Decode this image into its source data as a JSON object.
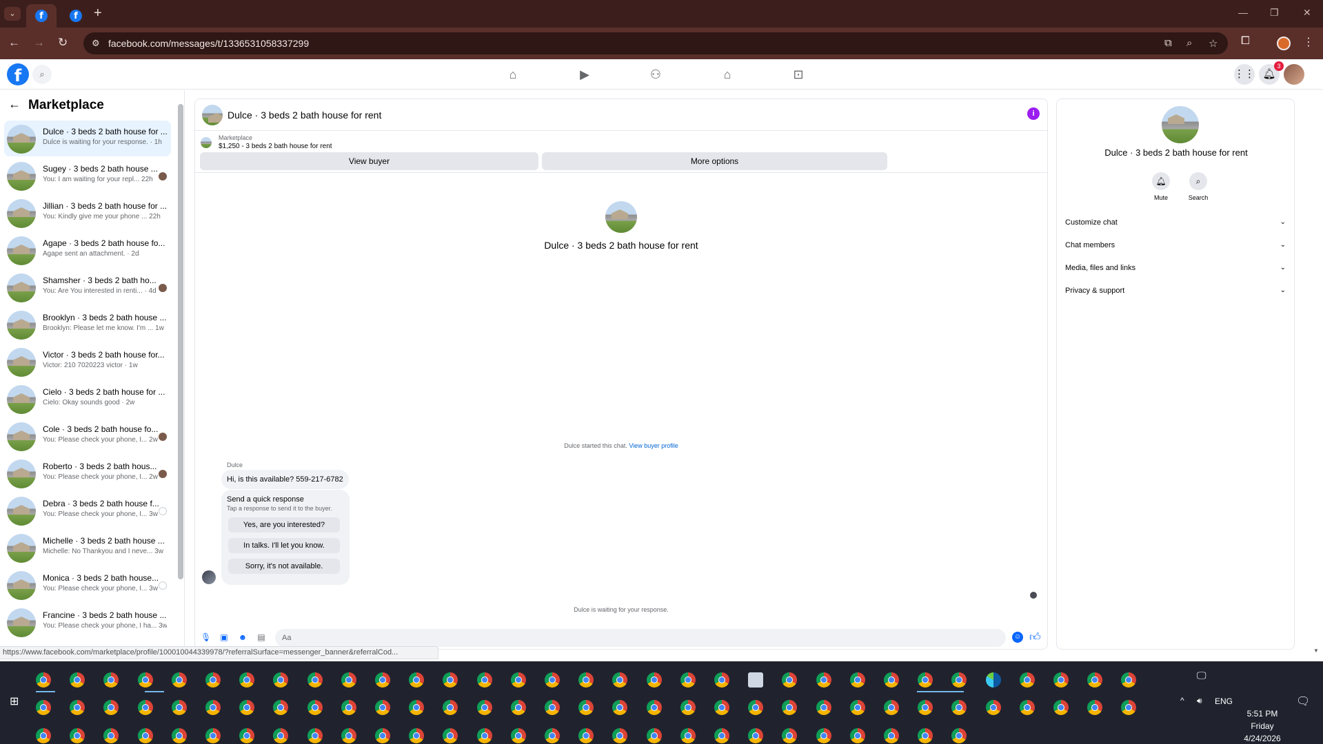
{
  "browser": {
    "url": "facebook.com/messages/t/1336531058337299",
    "status_url": "https://www.facebook.com/marketplace/profile/100010044339978/?referralSurface=messenger_banner&referralCod..."
  },
  "fb": {
    "logo_glyph": "f",
    "notifications_count": "3",
    "nav_icons": [
      "home-icon",
      "video-icon",
      "friends-icon",
      "marketplace-icon",
      "gaming-icon"
    ]
  },
  "sidebar": {
    "title": "Marketplace",
    "conversations": [
      {
        "title": "Dulce · 3 beds 2 bath house for ...",
        "subtitle": "Dulce is waiting for your response. · 1h",
        "mark": "none"
      },
      {
        "title": "Sugey · 3 beds 2 bath house ...",
        "subtitle": "You: I am waiting for your repl...  22h",
        "mark": "face"
      },
      {
        "title": "Jillian · 3 beds 2 bath house for ...",
        "subtitle": "You: Kindly give me your phone ...  22h",
        "mark": "none"
      },
      {
        "title": "Agape · 3 beds 2 bath house fo...",
        "subtitle": "Agape sent an attachment. · 2d",
        "mark": "none"
      },
      {
        "title": "Shamsher · 3 beds 2 bath ho...",
        "subtitle": "You: Are You interested in renti...  · 4d",
        "mark": "face"
      },
      {
        "title": "Brooklyn · 3 beds 2 bath house ...",
        "subtitle": "Brooklyn: Please let me know. I'm ...  1w",
        "mark": "none"
      },
      {
        "title": "Victor · 3 beds 2 bath house for...",
        "subtitle": "Victor: 210 7020223 victor · 1w",
        "mark": "none"
      },
      {
        "title": "Cielo · 3 beds 2 bath house for ...",
        "subtitle": "Cielo: Okay sounds good · 2w",
        "mark": "none"
      },
      {
        "title": "Cole · 3 beds 2 bath house fo...",
        "subtitle": "You: Please check your phone, I...  2w",
        "mark": "face"
      },
      {
        "title": "Roberto · 3 beds 2 bath hous...",
        "subtitle": "You: Please check your phone, I...  2w",
        "mark": "face"
      },
      {
        "title": "Debra · 3 beds 2 bath house f...",
        "subtitle": "You: Please check your phone, I...  3w",
        "mark": "ring"
      },
      {
        "title": "Michelle · 3 beds 2 bath house ...",
        "subtitle": "Michelle: No Thankyou and I neve...  3w",
        "mark": "none"
      },
      {
        "title": "Monica · 3 beds 2 bath house...",
        "subtitle": "You: Please check your phone, I...  3w",
        "mark": "ring"
      },
      {
        "title": "Francine · 3 beds 2 bath house ...",
        "subtitle": "You: Please check your phone, I ha...  3w",
        "mark": "none"
      }
    ]
  },
  "chat": {
    "title": "Dulce · 3 beds 2 bath house for rent",
    "marketplace_label": "Marketplace",
    "listing": "$1,250 - 3 beds 2 bath house for rent",
    "view_buyer": "View buyer",
    "more_options": "More options",
    "hero_title": "Dulce · 3 beds 2 bath house for rent",
    "started_text": "Dulce started this chat.",
    "view_buyer_profile": "View buyer profile",
    "sender": "Dulce",
    "message": "Hi, is this available? 559-217-6782",
    "quick_title": "Send a quick response",
    "quick_sub": "Tap a response to send it to the buyer.",
    "quick_options": [
      "Yes, are you interested?",
      "In talks. I'll let you know.",
      "Sorry, it's not available."
    ],
    "waiting": "Dulce is waiting for your response.",
    "composer_placeholder": "Aa"
  },
  "details": {
    "title": "Dulce · 3 beds 2 bath house for rent",
    "mute": "Mute",
    "search": "Search",
    "sections": [
      "Customize chat",
      "Chat members",
      "Media, files and links",
      "Privacy & support"
    ]
  },
  "taskbar": {
    "language": "ENG",
    "time": "5:51 PM",
    "day": "Friday",
    "date": "4/24/2026"
  }
}
